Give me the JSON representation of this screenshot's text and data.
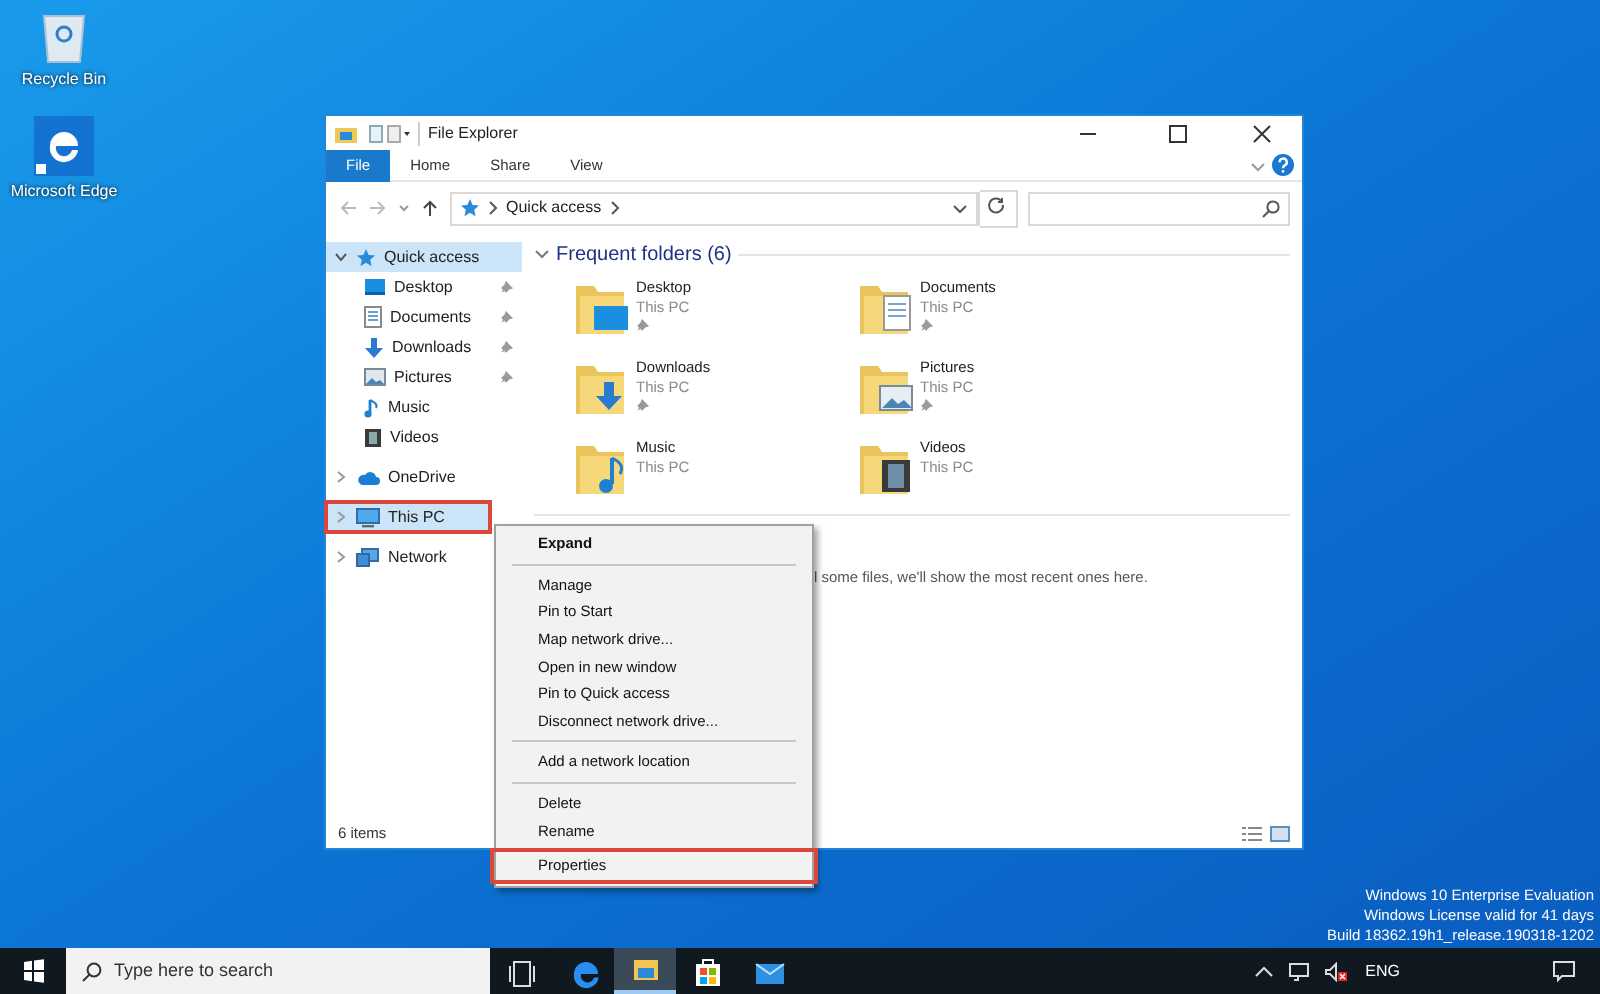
{
  "desktop_icons": [
    {
      "kind": "recycle",
      "label": "Recycle Bin"
    },
    {
      "kind": "edge",
      "label": "Microsoft Edge"
    }
  ],
  "window": {
    "title": "File Explorer",
    "ribbon_tabs": [
      {
        "label": "File",
        "selected": true
      },
      {
        "label": "Home",
        "selected": false
      },
      {
        "label": "Share",
        "selected": false
      },
      {
        "label": "View",
        "selected": false
      }
    ],
    "address": {
      "path": [
        "Quick access"
      ]
    },
    "nav": [
      {
        "label": "Quick access",
        "kind": "star",
        "selected": true,
        "expanded": true,
        "highlighted": false,
        "children": [
          {
            "label": "Desktop",
            "kind": "desktop",
            "pinned": true
          },
          {
            "label": "Documents",
            "kind": "documents",
            "pinned": true
          },
          {
            "label": "Downloads",
            "kind": "downloads",
            "pinned": true
          },
          {
            "label": "Pictures",
            "kind": "pictures",
            "pinned": true
          },
          {
            "label": "Music",
            "kind": "music",
            "pinned": false
          },
          {
            "label": "Videos",
            "kind": "videos",
            "pinned": false
          }
        ]
      },
      {
        "label": "OneDrive",
        "kind": "cloud",
        "selected": false,
        "expanded": false,
        "highlighted": false
      },
      {
        "label": "This PC",
        "kind": "pc",
        "selected": true,
        "expanded": false,
        "highlighted": true
      },
      {
        "label": "Network",
        "kind": "network",
        "selected": false,
        "expanded": false,
        "highlighted": false
      }
    ],
    "section_title": "Frequent folders (6)",
    "folders": [
      {
        "name": "Desktop",
        "location": "This PC",
        "kind": "desktop",
        "pinned": true
      },
      {
        "name": "Documents",
        "location": "This PC",
        "kind": "documents",
        "pinned": true
      },
      {
        "name": "Downloads",
        "location": "This PC",
        "kind": "downloads",
        "pinned": true
      },
      {
        "name": "Pictures",
        "location": "This PC",
        "kind": "pictures",
        "pinned": true
      },
      {
        "name": "Music",
        "location": "This PC",
        "kind": "music",
        "pinned": false
      },
      {
        "name": "Videos",
        "location": "This PC",
        "kind": "videos",
        "pinned": false
      }
    ],
    "recent_message": "l some files, we'll show the most recent ones here.",
    "status_bar": {
      "count": "6 items"
    }
  },
  "context_menu": [
    {
      "kind": "item",
      "label": "Expand",
      "default": true,
      "highlighted": false
    },
    {
      "kind": "separator"
    },
    {
      "kind": "item",
      "label": "Manage",
      "default": false,
      "highlighted": false
    },
    {
      "kind": "item",
      "label": "Pin to Start",
      "default": false,
      "highlighted": false
    },
    {
      "kind": "item",
      "label": "Map network drive...",
      "default": false,
      "highlighted": false
    },
    {
      "kind": "item",
      "label": "Open in new window",
      "default": false,
      "highlighted": false
    },
    {
      "kind": "item",
      "label": "Pin to Quick access",
      "default": false,
      "highlighted": false
    },
    {
      "kind": "item",
      "label": "Disconnect network drive...",
      "default": false,
      "highlighted": false
    },
    {
      "kind": "separator"
    },
    {
      "kind": "item",
      "label": "Add a network location",
      "default": false,
      "highlighted": false
    },
    {
      "kind": "separator"
    },
    {
      "kind": "item",
      "label": "Delete",
      "default": false,
      "highlighted": false
    },
    {
      "kind": "item",
      "label": "Rename",
      "default": false,
      "highlighted": false
    },
    {
      "kind": "item",
      "label": "Properties",
      "default": false,
      "highlighted": true
    }
  ],
  "activation_notice": [
    "Windows 10 Enterprise Evaluation",
    "Windows License valid for 41 days",
    "Build 18362.19h1_release.190318-1202"
  ],
  "taskbar": {
    "search": {
      "placeholder": "Type here to search"
    },
    "apps": [
      {
        "kind": "taskview",
        "active": false
      },
      {
        "kind": "edge",
        "active": false
      },
      {
        "kind": "explorer",
        "active": true
      },
      {
        "kind": "store",
        "active": false
      },
      {
        "kind": "mail",
        "active": false
      }
    ],
    "language": "ENG"
  }
}
